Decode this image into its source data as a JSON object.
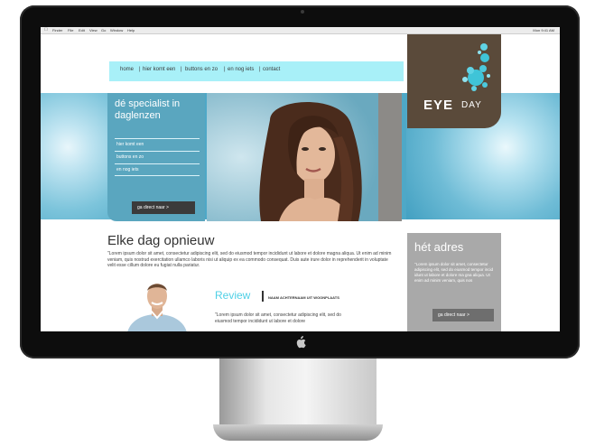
{
  "menubar": {
    "items": [
      "Finder",
      "File",
      "Edit",
      "View",
      "Go",
      "Window",
      "Help"
    ],
    "clock": "Mon 9:41 AM"
  },
  "nav": {
    "items": [
      "home",
      "hier komt een",
      "buttons en zo",
      "en nog iets",
      "contact"
    ],
    "separator": "|"
  },
  "logo": {
    "mark": "d",
    "eye": "EYE",
    "day": "DAY"
  },
  "sidebar": {
    "title": "dé specialist in daglenzen",
    "items": [
      "hier komt een",
      "buttons en zo",
      "en nog iets"
    ],
    "button": "ga direct naar  >"
  },
  "main": {
    "heading": "Elke dag opnieuw",
    "paragraph": "\"Lorem ipsum dolor sit amet, consectetur adipiscing elit, sed do eiusmod tempor incididunt ut labore et dolore magna aliqua. Ut enim ad minim veniam, quis nostrud exercitation ullamco laboris nisi ut aliquip ex ea commodo consequat. Duis aute irure dolor in reprehenderit in voluptate velit esse cillum dolore eu fugiat nulla pariatur."
  },
  "review": {
    "title": "Review",
    "subtitle": "NAAM ACHTERNAAM UIT WOONPLAATS",
    "text": "\"Lorem ipsum dolor sit amet, consectetur adipiscing elit, sed do eiusmod tempor incididunt ut labore et dolore"
  },
  "address": {
    "title": "hét adres",
    "text": "\"Lorem ipsum dolor sit amet, consectetur adipiscing elit, sed do eiusmod tempor incid idunt ut labore et dolore ma gna aliqua. Ut enim ad minim veniam, quis nos",
    "button": "ga direct naar  >"
  },
  "colors": {
    "nav_bg": "#a8f0f8",
    "teal": "#5aa6bf",
    "logo_bg": "#5a4a3a",
    "accent": "#4fd0e6",
    "address_bg": "#a9a9a9"
  }
}
